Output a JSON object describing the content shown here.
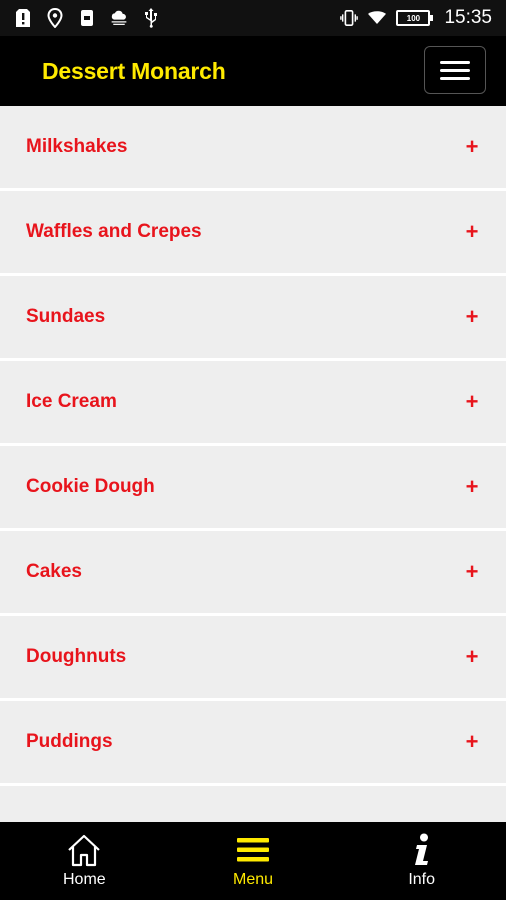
{
  "status_bar": {
    "time": "15:35",
    "battery": "100",
    "icons": [
      "alert-icon",
      "location-pin-icon",
      "sd-card-icon",
      "weather-icon",
      "usb-icon",
      "vibrate-icon",
      "wifi-icon",
      "battery-icon"
    ]
  },
  "header": {
    "title": "Dessert Monarch",
    "menu_icon": "hamburger-icon"
  },
  "menu": {
    "items": [
      {
        "label": "Milkshakes",
        "expand": "+"
      },
      {
        "label": "Waffles and Crepes",
        "expand": "+"
      },
      {
        "label": "Sundaes",
        "expand": "+"
      },
      {
        "label": "Ice Cream",
        "expand": "+"
      },
      {
        "label": "Cookie Dough",
        "expand": "+"
      },
      {
        "label": "Cakes",
        "expand": "+"
      },
      {
        "label": "Doughnuts",
        "expand": "+"
      },
      {
        "label": "Puddings",
        "expand": "+"
      }
    ]
  },
  "bottom_nav": {
    "items": [
      {
        "label": "Home",
        "icon": "home-icon",
        "active": false
      },
      {
        "label": "Menu",
        "icon": "menu-icon",
        "active": true
      },
      {
        "label": "Info",
        "icon": "info-icon",
        "active": false
      }
    ]
  },
  "colors": {
    "accent_yellow": "#ffea00",
    "item_red": "#e8141c",
    "item_background": "#eeeeee",
    "bar_background": "#000000"
  }
}
